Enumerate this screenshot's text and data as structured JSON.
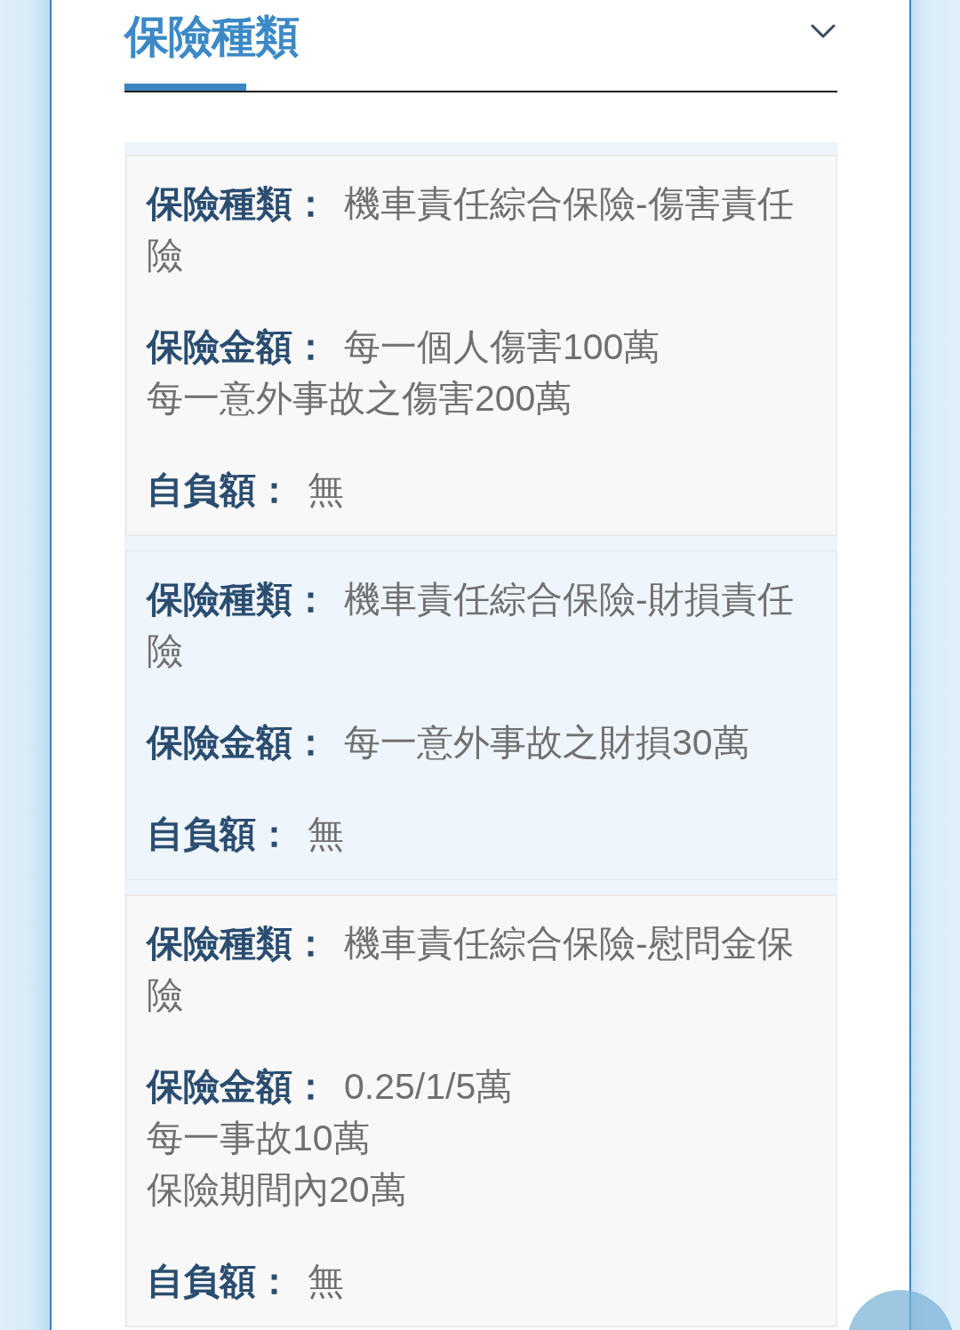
{
  "header": {
    "title": "保險種類"
  },
  "policies": [
    {
      "fields": [
        {
          "label": "保險種類：",
          "lines": [
            "機車責任綜合保險-傷害責任險"
          ]
        },
        {
          "label": "保險金額：",
          "lines": [
            "每一個人傷害100萬",
            "每一意外事故之傷害200萬"
          ]
        },
        {
          "label": "自負額：",
          "lines": [
            "無"
          ]
        }
      ]
    },
    {
      "fields": [
        {
          "label": "保險種類：",
          "lines": [
            "機車責任綜合保險-財損責任險"
          ]
        },
        {
          "label": "保險金額：",
          "lines": [
            "每一意外事故之財損30萬"
          ]
        },
        {
          "label": "自負額：",
          "lines": [
            "無"
          ]
        }
      ]
    },
    {
      "fields": [
        {
          "label": "保險種類：",
          "lines": [
            "機車責任綜合保險-慰問金保險"
          ]
        },
        {
          "label": "保險金額：",
          "lines": [
            "0.25/1/5萬",
            "每一事故10萬",
            "保險期間內20萬"
          ]
        },
        {
          "label": "自負額：",
          "lines": [
            "無"
          ]
        }
      ]
    }
  ]
}
